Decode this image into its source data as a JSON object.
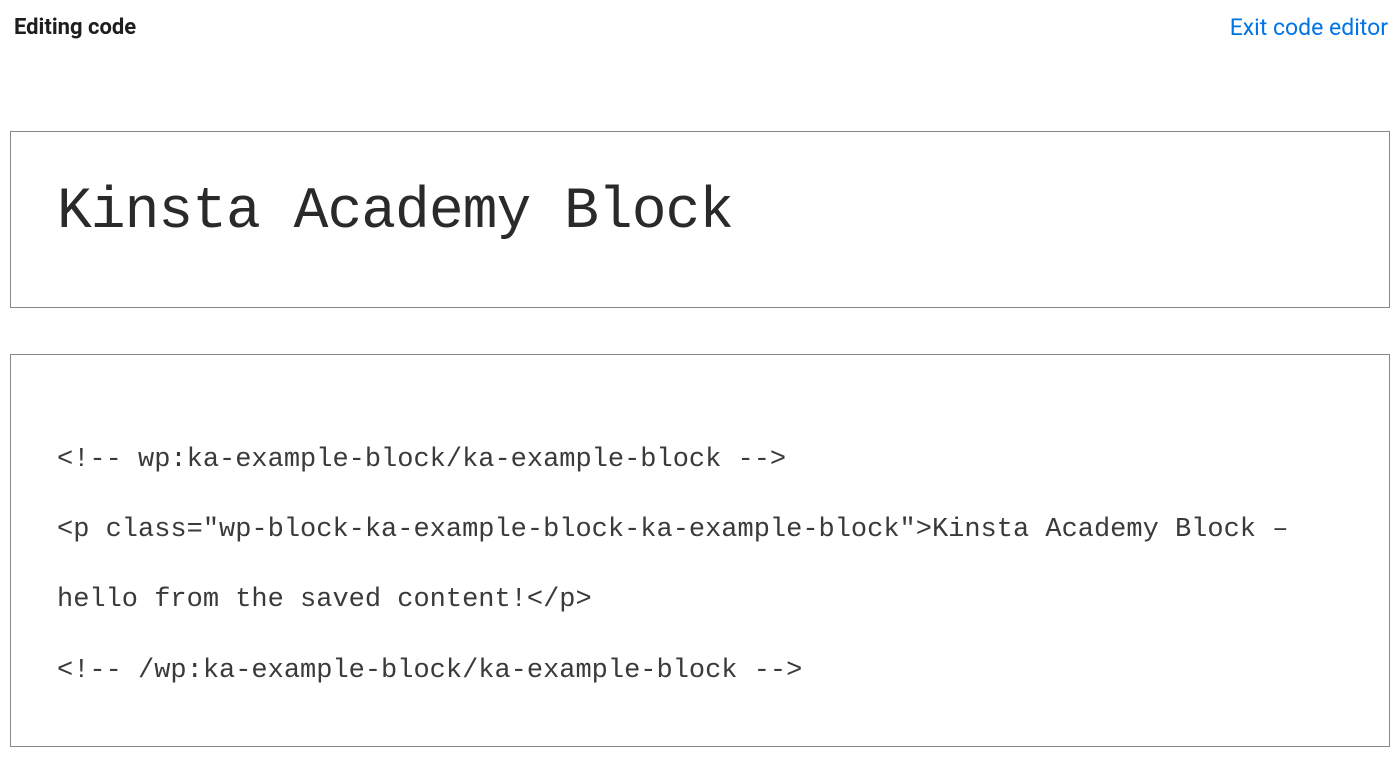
{
  "topbar": {
    "title": "Editing code",
    "exit_label": "Exit code editor"
  },
  "title_block": {
    "value": "Kinsta Academy Block"
  },
  "code_block": {
    "value": "<!-- wp:ka-example-block/ka-example-block -->\n<p class=\"wp-block-ka-example-block-ka-example-block\">Kinsta Academy Block – hello from the saved content!</p>\n<!-- /wp:ka-example-block/ka-example-block -->"
  }
}
